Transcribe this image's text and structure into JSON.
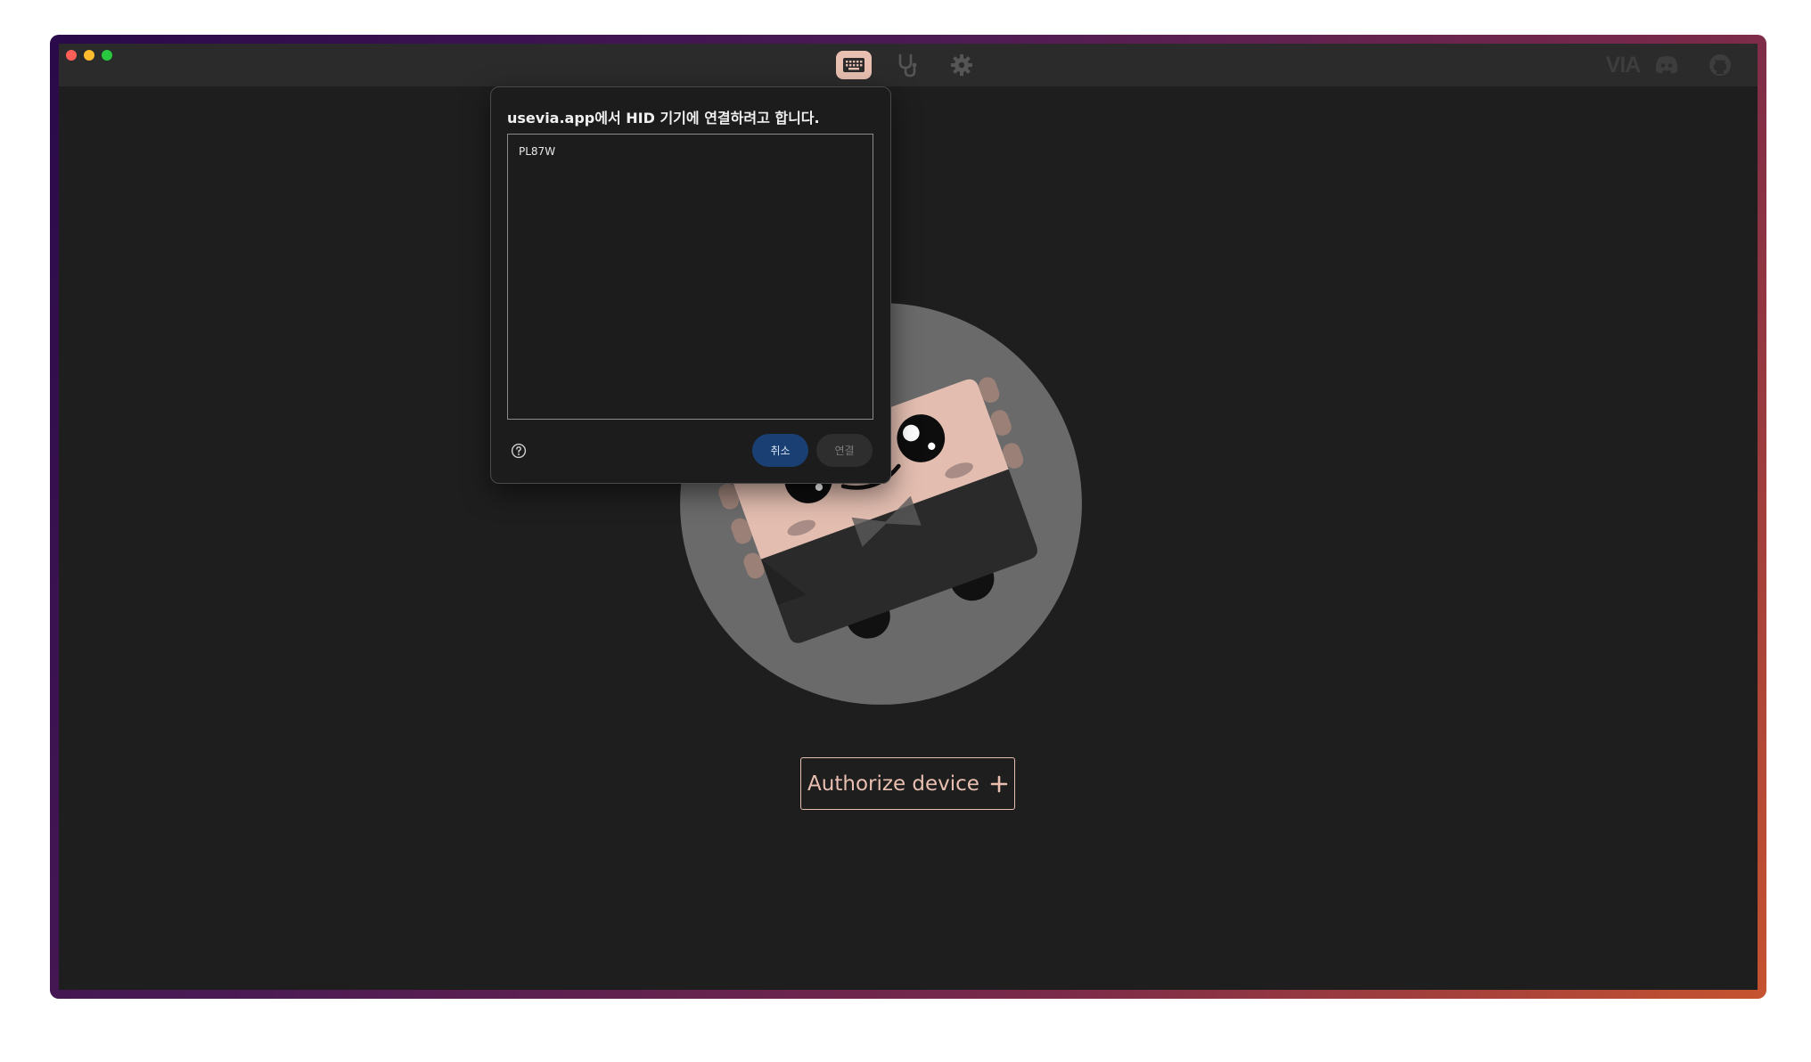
{
  "window": {
    "traffic_lights": {
      "close": "#ff5f57",
      "minimize": "#febc2e",
      "maximize": "#28c840"
    }
  },
  "nav": {
    "items": [
      {
        "icon": "keyboard-icon",
        "active": true
      },
      {
        "icon": "stethoscope-icon",
        "active": false
      },
      {
        "icon": "gear-icon",
        "active": false
      }
    ]
  },
  "brand": {
    "logo_text": "VIA",
    "links": [
      {
        "icon": "discord-icon"
      },
      {
        "icon": "github-icon"
      }
    ]
  },
  "main": {
    "authorize_label": "Authorize device",
    "authorize_icon": "plus-icon"
  },
  "dialog": {
    "title": "usevia.app에서 HID 기기에 연결하려고 합니다.",
    "devices": [
      "PL87W"
    ],
    "cancel_label": "취소",
    "connect_label": "연결",
    "help_icon": "help-icon"
  },
  "colors": {
    "accent": "#e8bfb0",
    "background": "#1e1e1e",
    "cancel_button": "#1a3f73"
  }
}
